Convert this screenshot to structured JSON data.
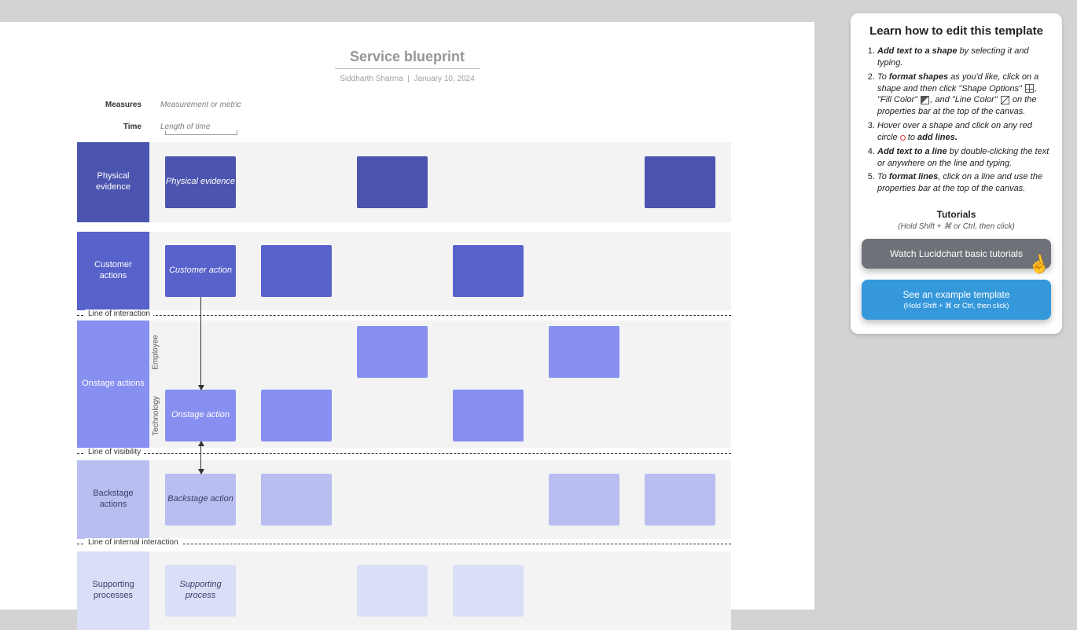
{
  "header": {
    "title": "Service blueprint",
    "author": "Siddharth Sharma",
    "date": "January 10, 2024"
  },
  "meta": {
    "measures_label": "Measures",
    "measures_placeholder": "Measurement or metric",
    "time_label": "Time",
    "time_placeholder": "Length of time"
  },
  "colors": {
    "physical": "#4b55b0",
    "customer": "#5762cb",
    "onstage": "#878ff0",
    "backstage": "#b8beef",
    "support": "#dadef6",
    "track": "#f3f3f3"
  },
  "separators": {
    "interaction": "Line of interaction",
    "visibility": "Line of visibility",
    "internal": "Line of internal interaction"
  },
  "lanes": {
    "physical": {
      "label": "Physical evidence",
      "box_label": "Physical evidence"
    },
    "customer": {
      "label": "Customer actions",
      "box_label": "Customer action"
    },
    "onstage": {
      "label": "Onstage actions",
      "sub_emp": "Employee",
      "sub_tech": "Technology",
      "box_label": "Onstage action"
    },
    "backstage": {
      "label": "Backstage actions",
      "box_label": "Backstage action"
    },
    "support": {
      "label": "Supporting processes",
      "box_label": "Supporting process"
    }
  },
  "panel": {
    "title": "Learn how to edit this template",
    "steps": {
      "s1a": "Add text to a shape",
      "s1b": " by selecting it and typing.",
      "s2a": "To ",
      "s2b": "format shapes",
      "s2c": " as you'd like, click on a shape and then click \"Shape Options\" ",
      "s2d": ", \"Fill Color\" ",
      "s2e": ", and \"Line Color\" ",
      "s2f": " on the properties bar at the top of the canvas.",
      "s3a": "Hover over a shape and click on any red circle ",
      "s3b": " to ",
      "s3c": "add lines.",
      "s4a": "Add text to a line",
      "s4b": " by double-clicking the text or anywhere on the line and typing.",
      "s5a": "To ",
      "s5b": "format lines",
      "s5c": ", click on a line and use the properties bar at the top of the canvas."
    },
    "tutorials": {
      "head": "Tutorials",
      "sub": "(Hold Shift + ⌘ or Ctrl, then click)",
      "btn1": "Watch Lucidchart basic tutorials",
      "btn2": "See an example template",
      "btn2_sub": "(Hold Shift + ⌘ or Ctrl, then click)"
    }
  }
}
